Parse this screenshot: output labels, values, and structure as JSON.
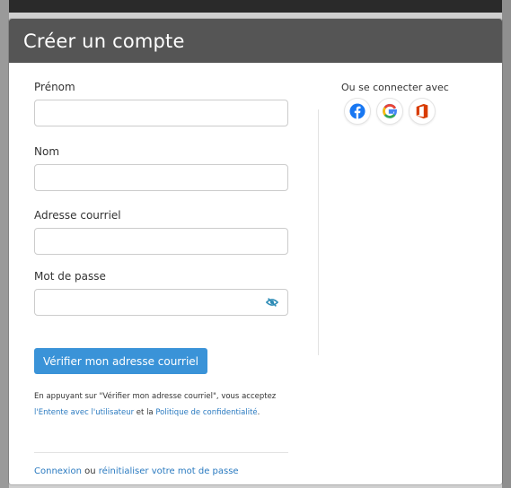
{
  "modal": {
    "title": "Créer un compte"
  },
  "form": {
    "first_name_label": "Prénom",
    "first_name_value": "",
    "last_name_label": "Nom",
    "last_name_value": "",
    "email_label": "Adresse courriel",
    "email_value": "",
    "password_label": "Mot de passe",
    "password_value": "",
    "submit_label": "Vérifier mon adresse courriel"
  },
  "terms": {
    "prefix": "En appuyant sur \"Vérifier mon adresse courriel\", vous acceptez ",
    "user_agreement_link": "l'Entente avec l'utilisateur",
    "middle": " et la ",
    "privacy_link": "Politique de confidentialité",
    "suffix": "."
  },
  "footer": {
    "login_link": "Connexion",
    "or_text": " ou ",
    "reset_link": "réinitialiser votre mot de passe"
  },
  "social": {
    "title": "Ou se connecter avec",
    "providers": [
      {
        "icon": "facebook-icon",
        "color": "#1877f2"
      },
      {
        "icon": "google-icon",
        "color": "#4285f4"
      },
      {
        "icon": "office-icon",
        "color": "#d83b01"
      }
    ]
  },
  "colors": {
    "header_bg": "#555555",
    "primary": "#3a93d8",
    "link": "#2a7ac0",
    "eye_icon": "#2a8ab5"
  }
}
